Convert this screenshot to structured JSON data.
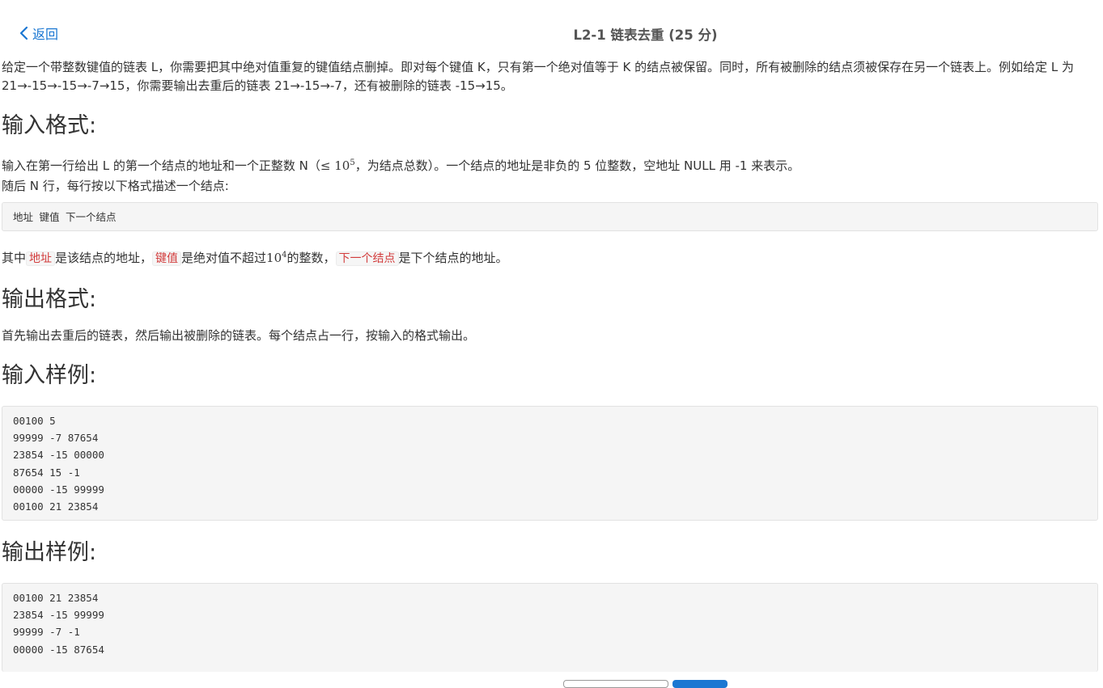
{
  "header": {
    "back_label": "返回",
    "title": "L2-1 链表去重 (25 分)"
  },
  "problem": {
    "description": "给定一个带整数键值的链表 L，你需要把其中绝对值重复的键值结点删掉。即对每个键值 K，只有第一个绝对值等于 K 的结点被保留。同时，所有被删除的结点须被保存在另一个链表上。例如给定 L 为 21→-15→-15→-7→15，你需要输出去重后的链表 21→-15→-7，还有被删除的链表 -15→15。",
    "input_heading": "输入格式:",
    "input_line1_pre": "输入在第一行给出 L 的第一个结点的地址和一个正整数 N（",
    "input_line1_math": "≤ 10",
    "input_line1_exp": "5",
    "input_line1_post": "，为结点总数）。一个结点的地址是非负的 5 位整数，空地址 NULL 用 -1 来表示。",
    "input_line2": "随后 N 行，每行按以下格式描述一个结点:",
    "format_code": "地址 键值 下一个结点",
    "explain_pre": "其中",
    "explain_code1": "地址",
    "explain_mid1": "是该结点的地址，",
    "explain_code2": "键值",
    "explain_mid2": "是绝对值不超过",
    "explain_math": "10",
    "explain_exp": "4",
    "explain_mid3": "的整数，",
    "explain_code3": "下一个结点",
    "explain_post": "是下个结点的地址。",
    "output_heading": "输出格式:",
    "output_text": "首先输出去重后的链表，然后输出被删除的链表。每个结点占一行，按输入的格式输出。",
    "sample_input_heading": "输入样例:",
    "sample_input": [
      "00100 5",
      "99999 -7 87654",
      "23854 -15 00000",
      "87654 15 -1",
      "00000 -15 99999",
      "00100 21 23854"
    ],
    "sample_output_heading": "输出样例:",
    "sample_output": [
      "00100 21 23854",
      "23854 -15 99999",
      "99999 -7 -1",
      "00000 -15 87654"
    ]
  },
  "colors": {
    "link": "#1b77d2",
    "inline_code": "#d23c3c"
  }
}
